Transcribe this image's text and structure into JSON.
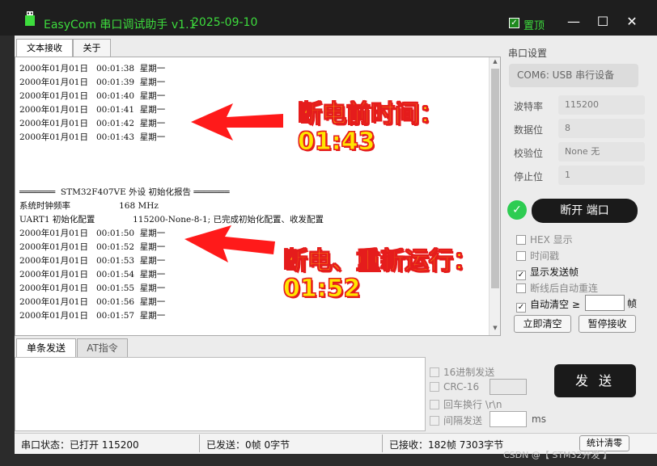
{
  "window": {
    "title": "EasyCom 串口调试助手 v1.1",
    "date": "2025-09-10",
    "pin_label": "置顶",
    "pin_checked": true,
    "minimize": "—",
    "maximize": "☐",
    "close": "✕"
  },
  "tabs": [
    {
      "label": "文本接收",
      "active": true
    },
    {
      "label": "关于",
      "active": false
    }
  ],
  "log_lines": [
    "2000年01月01日   00:01:38  星期一",
    "2000年01月01日   00:01:39  星期一",
    "2000年01月01日   00:01:40  星期一",
    "2000年01月01日   00:01:41  星期一",
    "2000年01月01日   00:01:42  星期一",
    "2000年01月01日   00:01:43  星期一",
    "",
    "",
    "",
    "═══════  STM32F407VE 外设 初始化报告 ═══════",
    "系统时钟频率                  168 MHz",
    "UART1 初始化配置              115200-None-8-1; 已完成初始化配置、收发配置",
    "2000年01月01日   00:01:50  星期一",
    "2000年01月01日   00:01:52  星期一",
    "2000年01月01日   00:01:53  星期一",
    "2000年01月01日   00:01:54  星期一",
    "2000年01月01日   00:01:55  星期一",
    "2000年01月01日   00:01:56  星期一",
    "2000年01月01日   00:01:57  星期一"
  ],
  "annotations": {
    "top_line1": "断电前时间：",
    "top_line2": "01:43",
    "bottom_line1": "断电、重新运行：",
    "bottom_line2": "01:52"
  },
  "serial": {
    "section_title": "串口设置",
    "port": "COM6: USB 串行设备",
    "fields": [
      {
        "label": "波特率",
        "value": "115200"
      },
      {
        "label": "数据位",
        "value": "8"
      },
      {
        "label": "校验位",
        "value": "None   无"
      },
      {
        "label": "停止位",
        "value": "1"
      }
    ],
    "status_icon": "✓",
    "connect_button": "断开 端口"
  },
  "options": [
    {
      "label": "HEX 显示",
      "checked": false
    },
    {
      "label": "时间戳",
      "checked": false
    },
    {
      "label": "显示发送帧",
      "checked": true
    },
    {
      "label": "断线后自动重连",
      "checked": false
    },
    {
      "label": "自动清空 ≥",
      "checked": true
    }
  ],
  "auto_clear_unit": "帧",
  "buttons": {
    "clear_now": "立即清空",
    "pause": "暂停接收",
    "send": "发 送",
    "stats_clear": "统计清零"
  },
  "send_tabs": [
    {
      "label": "单条发送",
      "active": true
    },
    {
      "label": "AT指令",
      "active": false
    }
  ],
  "send_options": [
    {
      "label": "16进制发送"
    },
    {
      "label": "CRC-16"
    },
    {
      "label": "回车换行 \\r\\n"
    },
    {
      "label": "间隔发送"
    }
  ],
  "interval_unit": "ms",
  "status": {
    "port_state": "串口状态：已打开 115200",
    "sent": "已发送：0帧    0字节",
    "received": "已接收：182帧    7303字节"
  },
  "watermark": "CSDN @【 STM32开发 】"
}
